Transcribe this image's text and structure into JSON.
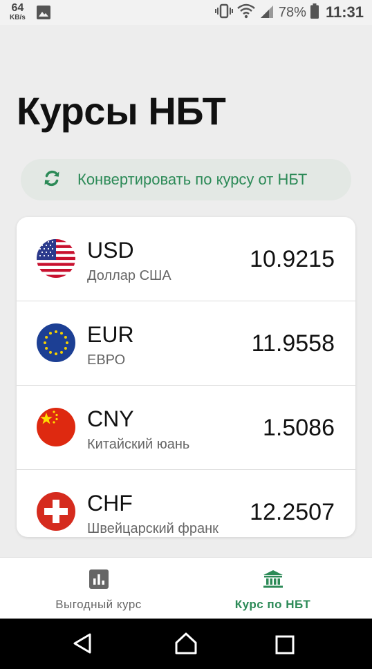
{
  "status_bar": {
    "net_speed_value": "64",
    "net_speed_unit": "KB/s",
    "battery_percent": "78%",
    "time": "11:31",
    "icons": [
      "gallery-icon",
      "vibrate-icon",
      "wifi-icon",
      "signal-icon",
      "battery-icon"
    ]
  },
  "page": {
    "title": "Курсы НБТ"
  },
  "convert_button": {
    "label": "Конвертировать по курсу от НБТ",
    "icon": "refresh-icon"
  },
  "currencies": [
    {
      "code": "USD",
      "name": "Доллар США",
      "rate": "10.9215",
      "flag": "us-flag-icon"
    },
    {
      "code": "EUR",
      "name": "ЕВРО",
      "rate": "11.9558",
      "flag": "eu-flag-icon"
    },
    {
      "code": "CNY",
      "name": "Китайский юань",
      "rate": "1.5086",
      "flag": "cn-flag-icon"
    },
    {
      "code": "CHF",
      "name": "Швейцарский франк",
      "rate": "12.2507",
      "flag": "ch-flag-icon"
    }
  ],
  "bottom_nav": {
    "items": [
      {
        "label": "Выгодный курс",
        "icon": "bar-chart-icon",
        "active": false
      },
      {
        "label": "Курс по НБТ",
        "icon": "bank-icon",
        "active": true
      }
    ]
  },
  "colors": {
    "accent": "#2c8a57",
    "background": "#ededed",
    "card": "#ffffff"
  }
}
